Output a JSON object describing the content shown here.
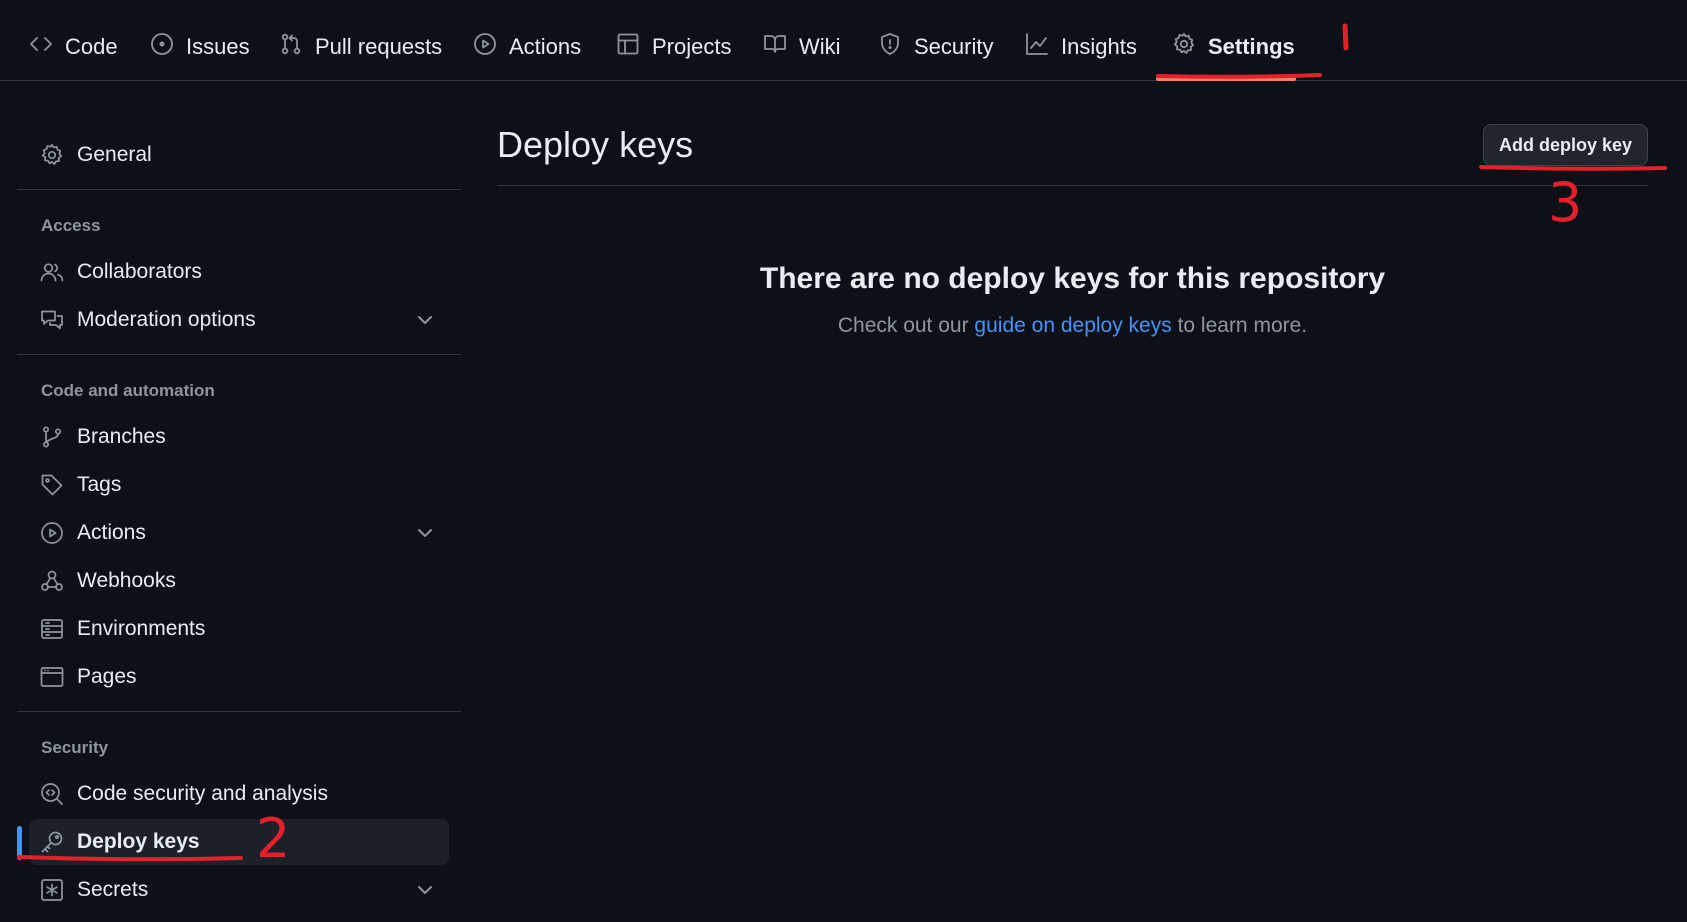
{
  "topnav": {
    "items": [
      {
        "label": "Code",
        "icon": "code-icon"
      },
      {
        "label": "Issues",
        "icon": "issue-opened-icon"
      },
      {
        "label": "Pull requests",
        "icon": "git-pull-request-icon"
      },
      {
        "label": "Actions",
        "icon": "play-icon"
      },
      {
        "label": "Projects",
        "icon": "table-icon"
      },
      {
        "label": "Wiki",
        "icon": "book-icon"
      },
      {
        "label": "Security",
        "icon": "shield-icon"
      },
      {
        "label": "Insights",
        "icon": "graph-icon"
      },
      {
        "label": "Settings",
        "icon": "gear-icon"
      }
    ],
    "selected": "Settings"
  },
  "sidebar": {
    "general": "General",
    "access_heading": "Access",
    "collaborators": "Collaborators",
    "moderation": "Moderation options",
    "code_heading": "Code and automation",
    "branches": "Branches",
    "tags": "Tags",
    "actions": "Actions",
    "webhooks": "Webhooks",
    "environments": "Environments",
    "pages": "Pages",
    "security_heading": "Security",
    "code_security": "Code security and analysis",
    "deploy_keys": "Deploy keys",
    "secrets": "Secrets"
  },
  "main": {
    "title": "Deploy keys",
    "add_button": "Add deploy key",
    "empty_title": "There are no deploy keys for this repository",
    "empty_prefix": "Check out our ",
    "empty_link": "guide on deploy keys",
    "empty_suffix": " to learn more."
  },
  "annotations": {
    "step1": "1",
    "step2": "2",
    "step3": "3",
    "color": "#e5202a"
  },
  "colors": {
    "background": "#0d1117",
    "accent_link": "#4493f8",
    "selected_tab_underline": "#f78166"
  }
}
